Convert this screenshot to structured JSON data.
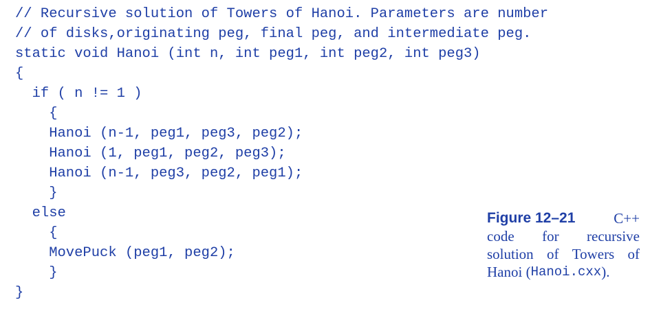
{
  "code": {
    "lines": [
      "// Recursive solution of Towers of Hanoi. Parameters are number",
      "// of disks,originating peg, final peg, and intermediate peg.",
      "static void Hanoi (int n, int peg1, int peg2, int peg3)",
      "{",
      "  if ( n != 1 )",
      "    {",
      "    Hanoi (n-1, peg1, peg3, peg2);",
      "    Hanoi (1, peg1, peg2, peg3);",
      "    Hanoi (n-1, peg3, peg2, peg1);",
      "    }",
      "  else",
      "    {",
      "    MovePuck (peg1, peg2);",
      "    }",
      "}"
    ]
  },
  "caption": {
    "label": "Figure 12–21",
    "line1_tail": "C++",
    "line2": [
      "code",
      "for",
      "recursive"
    ],
    "line3": [
      "solution",
      "of",
      "Towers",
      "of"
    ],
    "line4_prefix": "Hanoi (",
    "filename": "Hanoi.cxx",
    "line4_suffix": ")."
  },
  "colors": {
    "text": "#1f3fa6",
    "background": "#ffffff"
  }
}
